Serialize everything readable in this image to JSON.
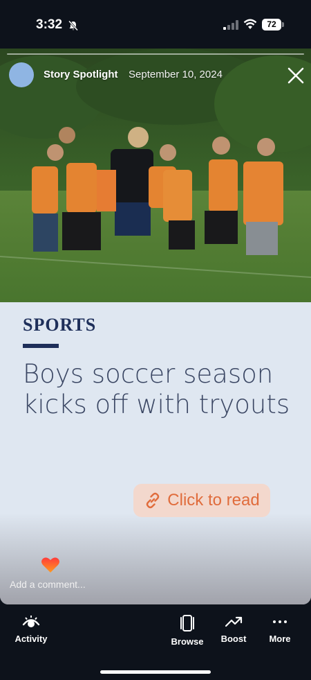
{
  "status_bar": {
    "time": "3:32",
    "battery": "72"
  },
  "story": {
    "title": "Story Spotlight",
    "date": "September 10, 2024",
    "section": "SPORTS",
    "headline": "Boys soccer season kicks off with tryouts",
    "read_label": "Click to read",
    "comment_placeholder": "Add a comment..."
  },
  "tabs": [
    {
      "label": "Activity",
      "icon": "eye-icon"
    },
    {
      "label": "Browse",
      "icon": "cards-icon"
    },
    {
      "label": "Boost",
      "icon": "trend-up-icon"
    },
    {
      "label": "More",
      "icon": "ellipsis-icon"
    }
  ],
  "colors": {
    "accent": "#e06c3c",
    "navy": "#1e2f5a",
    "card_bg": "#dfe7f1"
  }
}
